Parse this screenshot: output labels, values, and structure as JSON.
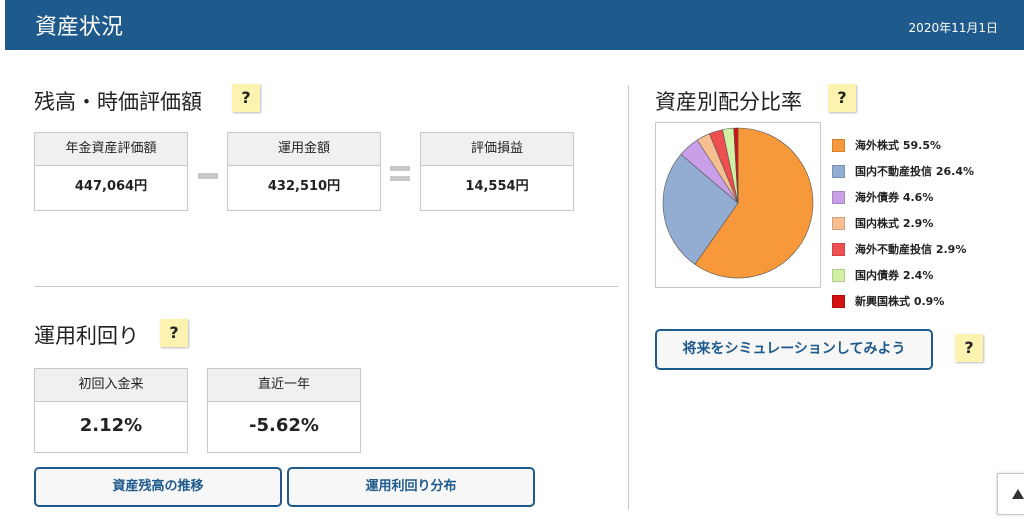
{
  "header": {
    "title": "資産状況",
    "date": "2020年11月1日"
  },
  "balance": {
    "title": "残高・時価評価額",
    "help": "?",
    "boxes": [
      {
        "label": "年金資産評価額",
        "value": "447,064円"
      },
      {
        "label": "運用金額",
        "value": "432,510円"
      },
      {
        "label": "評価損益",
        "value": "14,554円"
      }
    ]
  },
  "yield": {
    "title": "運用利回り",
    "help": "?",
    "boxes": [
      {
        "label": "初回入金来",
        "value": "2.12%"
      },
      {
        "label": "直近一年",
        "value": "-5.62%"
      }
    ],
    "buttons": {
      "history": "資産残高の推移",
      "distribution": "運用利回り分布"
    }
  },
  "allocation": {
    "title": "資産別配分比率",
    "help": "?",
    "simulate_button": "将来をシミュレーションしてみよう",
    "simulate_help": "?"
  },
  "chart_data": {
    "type": "pie",
    "title": "",
    "slices": [
      {
        "label": "海外株式 59.5%",
        "value": 59.5,
        "color": "#f7993a"
      },
      {
        "label": "国内不動産投信 26.4%",
        "value": 26.4,
        "color": "#93acd2"
      },
      {
        "label": "海外債券 4.6%",
        "value": 4.6,
        "color": "#c89fe8"
      },
      {
        "label": "国内株式 2.9%",
        "value": 2.9,
        "color": "#f7be92"
      },
      {
        "label": "海外不動産投信 2.9%",
        "value": 2.9,
        "color": "#ef4f50"
      },
      {
        "label": "国内債券 2.4%",
        "value": 2.4,
        "color": "#d2f0a4"
      },
      {
        "label": "新興国株式 0.9%",
        "value": 0.9,
        "color": "#d31010"
      }
    ],
    "legend_position": "right"
  },
  "scroll_top_icon": "triangle-up-icon"
}
